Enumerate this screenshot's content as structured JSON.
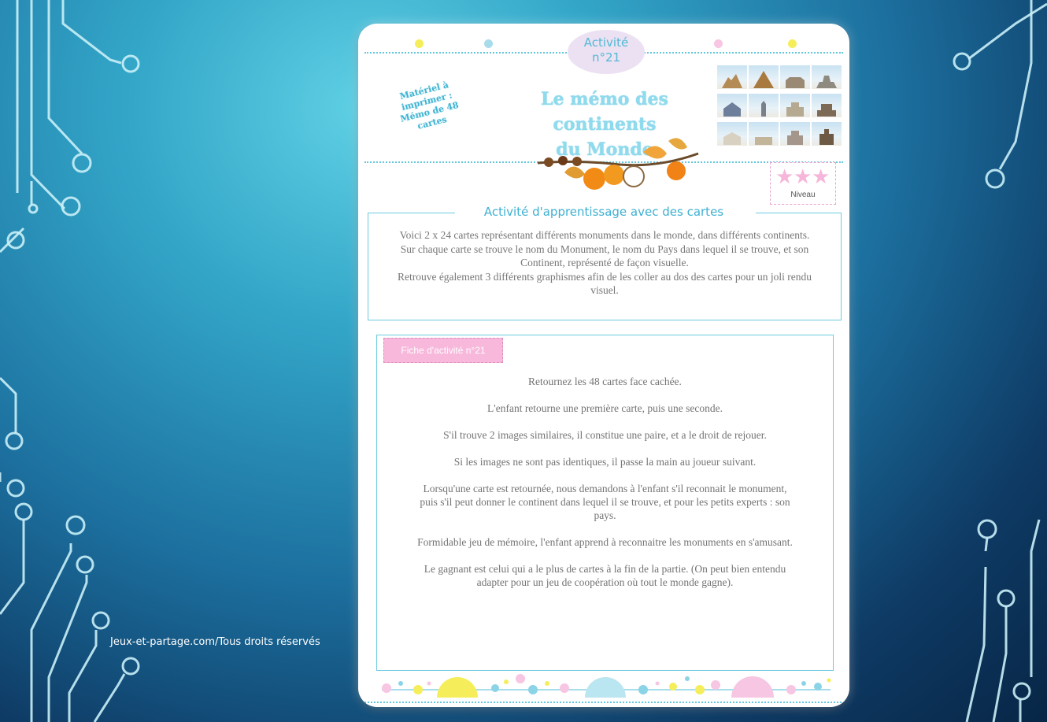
{
  "credit": "Jeux-et-partage.com/Tous droits réservés",
  "sheet": {
    "badge": {
      "line1": "Activité",
      "line2": "n°21"
    },
    "material": {
      "l1": "Matériel à",
      "l2": "imprimer :",
      "l3": "Mémo de 48",
      "l4": "cartes"
    },
    "title": {
      "line1": "Le mémo des continents",
      "line2": "du Monde"
    },
    "level_label": "Niveau",
    "level_stars": 3,
    "section_heading": "Activité d'apprentissage avec des cartes",
    "intro": [
      "Voici 2 x 24 cartes représentant différents monuments dans le monde, dans différents continents.",
      "Sur chaque carte se trouve le nom du Monument, le nom du Pays dans lequel il se trouve, et son Continent, représenté de façon visuelle.",
      "Retrouve également 3 différents graphismes afin de les coller au dos des cartes pour un joli rendu visuel."
    ],
    "activity_tab": "Fiche d'activité n°21",
    "steps": [
      "Retournez les 48 cartes face cachée.",
      "L'enfant retourne une première carte, puis une seconde.",
      "S'il trouve 2 images similaires, il constitue une paire, et a le droit de rejouer.",
      "Si les images ne sont pas identiques, il passe la main au joueur suivant.",
      "Lorsqu'une carte est retournée, nous demandons à l'enfant s'il reconnait le monument, puis s'il peut donner le continent dans lequel il se trouve, et pour les petits experts : son pays.",
      "Formidable jeu de mémoire, l'enfant apprend à reconnaitre les monuments en s'amusant.",
      "Le gagnant est celui qui a le plus de cartes à la fin de la partie. (On peut bien entendu adapter pour un jeu de coopération où tout le monde gagne)."
    ]
  },
  "colors": {
    "accent": "#52b9d6",
    "pink": "#f7b8db",
    "yellow": "#f5ee5a",
    "light_blue": "#b9e6f0"
  }
}
